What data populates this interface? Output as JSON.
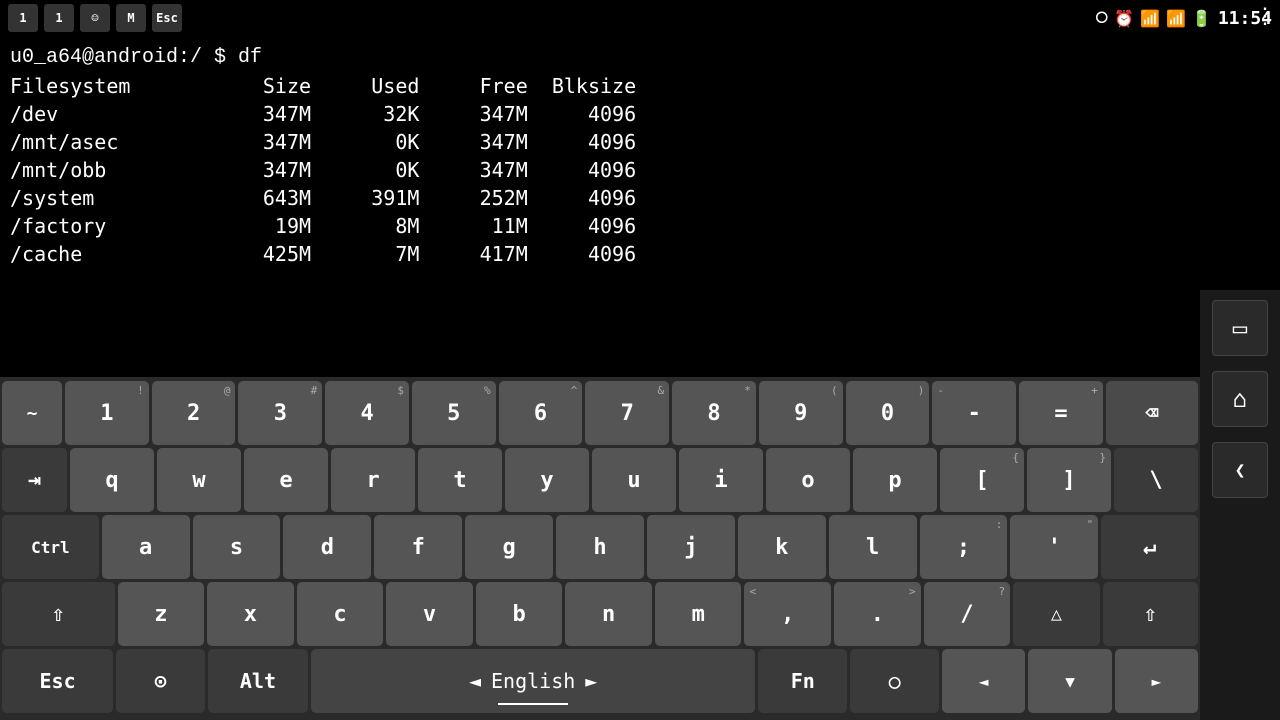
{
  "statusBar": {
    "time": "11:54",
    "icons": [
      "bluetooth",
      "alarm",
      "wifi",
      "signal",
      "battery"
    ]
  },
  "notifBar": {
    "icons": [
      "1",
      "1",
      "msg",
      "gmail",
      "esc"
    ]
  },
  "terminal": {
    "prompt": "u0_a64@android:/ $ df",
    "columns": "Filesystem           Size     Used     Free  Blksize",
    "rows": [
      {
        "fs": "/dev",
        "size": "347M",
        "used": "32K",
        "free": "347M",
        "blk": "4096"
      },
      {
        "fs": "/mnt/asec",
        "size": "347M",
        "used": "0K",
        "free": "347M",
        "blk": "4096"
      },
      {
        "fs": "/mnt/obb",
        "size": "347M",
        "used": "0K",
        "free": "347M",
        "blk": "4096"
      },
      {
        "fs": "/system",
        "size": "643M",
        "used": "391M",
        "free": "252M",
        "blk": "4096"
      },
      {
        "fs": "/factory",
        "size": "19M",
        "used": "8M",
        "free": "11M",
        "blk": "4096"
      },
      {
        "fs": "/cache",
        "size": "425M",
        "used": "7M",
        "free": "417M",
        "blk": "4096"
      }
    ]
  },
  "keyboard": {
    "row1": [
      "~",
      "1",
      "2",
      "3",
      "4",
      "5",
      "6",
      "7",
      "8",
      "9",
      "0",
      "-",
      "=",
      "⌫"
    ],
    "row1sub": [
      "",
      "!",
      "@",
      "#",
      "$",
      "%",
      "^",
      "&",
      "*",
      "(",
      ")",
      "",
      "+",
      ""
    ],
    "row2": [
      "⇥",
      "q",
      "w",
      "e",
      "r",
      "t",
      "y",
      "u",
      "i",
      "o",
      "p",
      "[",
      "]",
      "\\"
    ],
    "row2sub": [
      "",
      "",
      "",
      "",
      "",
      "",
      "",
      "",
      "",
      "",
      "",
      "{",
      "}",
      "|"
    ],
    "row3": [
      "Ctrl",
      "a",
      "s",
      "d",
      "f",
      "g",
      "h",
      "j",
      "k",
      "l",
      ";",
      "'",
      "↵"
    ],
    "row3sub": [
      "",
      "",
      "",
      "",
      "",
      "",
      "",
      "",
      "",
      "",
      ":",
      "\"",
      ""
    ],
    "row4": [
      "⇧",
      "z",
      "x",
      "c",
      "v",
      "b",
      "n",
      "m",
      ",",
      ".",
      "/",
      "△",
      "⇧"
    ],
    "row4sub": [
      "",
      "",
      "",
      "",
      "",
      "",
      "",
      "",
      "<",
      ">",
      "?",
      "",
      ""
    ],
    "bottomRow": [
      "Esc",
      "⊙",
      "Alt",
      "◄ English ►",
      "Fn",
      "○",
      "◄",
      "▼",
      "►"
    ]
  },
  "rightPanel": {
    "btn1": "▭",
    "btn2": "⌂",
    "btn3": "❮"
  },
  "language": "English"
}
